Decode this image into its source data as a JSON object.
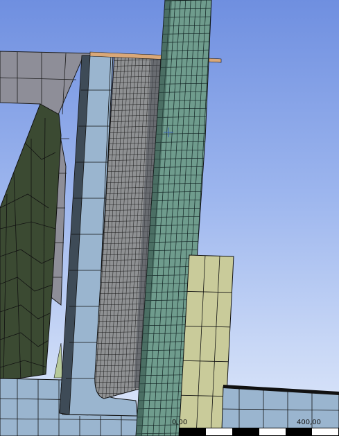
{
  "viewport": {
    "background_top": "#6f8fe0",
    "background_bottom": "#dfe8fa"
  },
  "scale_bar": {
    "label_start": "0,00",
    "label_end": "400,00",
    "colors": [
      "#000000",
      "#ffffff",
      "#000000",
      "#ffffff",
      "#000000",
      "#ffffff"
    ]
  },
  "colors": {
    "frame_grey": "#8e8e98",
    "dark_green": "#3b4a32",
    "light_blue": "#9ab5cf",
    "column_teal": "#6f9c8d",
    "fine_mesh_grey": "#8f9193",
    "khaki": "#c9cb9a",
    "tan": "#d9a878",
    "mesh_line": "#1a1a1a"
  },
  "cursor": {
    "icon": "crosshair-icon"
  }
}
